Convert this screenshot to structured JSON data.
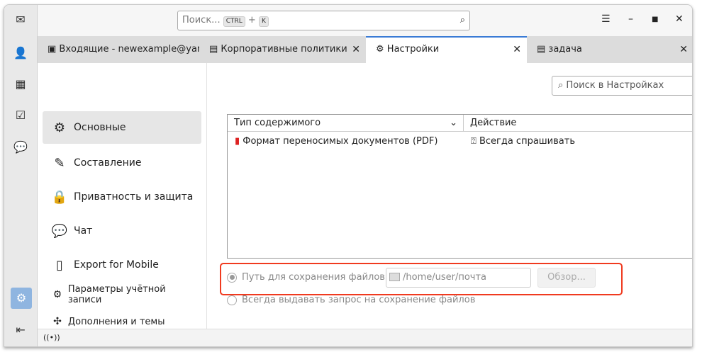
{
  "spaces": [
    "mail-icon",
    "address-book-icon",
    "calendar-icon",
    "tasks-icon",
    "chat-icon",
    "settings-icon",
    "collapse-icon"
  ],
  "search": {
    "placeholder": "Поиск...",
    "key1": "CTRL",
    "plus": "+",
    "key2": "K"
  },
  "tabs": [
    {
      "label": "Входящие - newexample@yandex.ru",
      "icon": "inbox-icon"
    },
    {
      "label": "Корпоративные политики",
      "icon": "document-icon"
    },
    {
      "label": "Настройки",
      "icon": "gear-icon",
      "active": true
    },
    {
      "label": "задача",
      "icon": "document-icon"
    }
  ],
  "nav": [
    {
      "label": "Основные",
      "icon": "gear-icon",
      "active": true
    },
    {
      "label": "Составление",
      "icon": "pencil-icon"
    },
    {
      "label": "Приватность и защита",
      "icon": "lock-icon"
    },
    {
      "label": "Чат",
      "icon": "chat-icon"
    },
    {
      "label": "Export for Mobile",
      "icon": "mobile-icon"
    },
    {
      "label": "Параметры учётной записи",
      "icon": "account-icon"
    },
    {
      "label": "Дополнения и темы",
      "icon": "puzzle-icon"
    }
  ],
  "prefsearch": "Поиск в Настройках",
  "table": {
    "col1": "Тип содержимого",
    "col2": "Действие",
    "rows": [
      {
        "type": "Формат переносимых документов (PDF)",
        "action": "Всегда спрашивать"
      }
    ]
  },
  "save": {
    "path_label": "Путь для сохранения файлов",
    "path": "/home/user/почта",
    "browse": "Обзор...",
    "ask_label": "Всегда выдавать запрос на сохранение файлов",
    "selected": "path",
    "highlight_color": "#f03a1f"
  }
}
